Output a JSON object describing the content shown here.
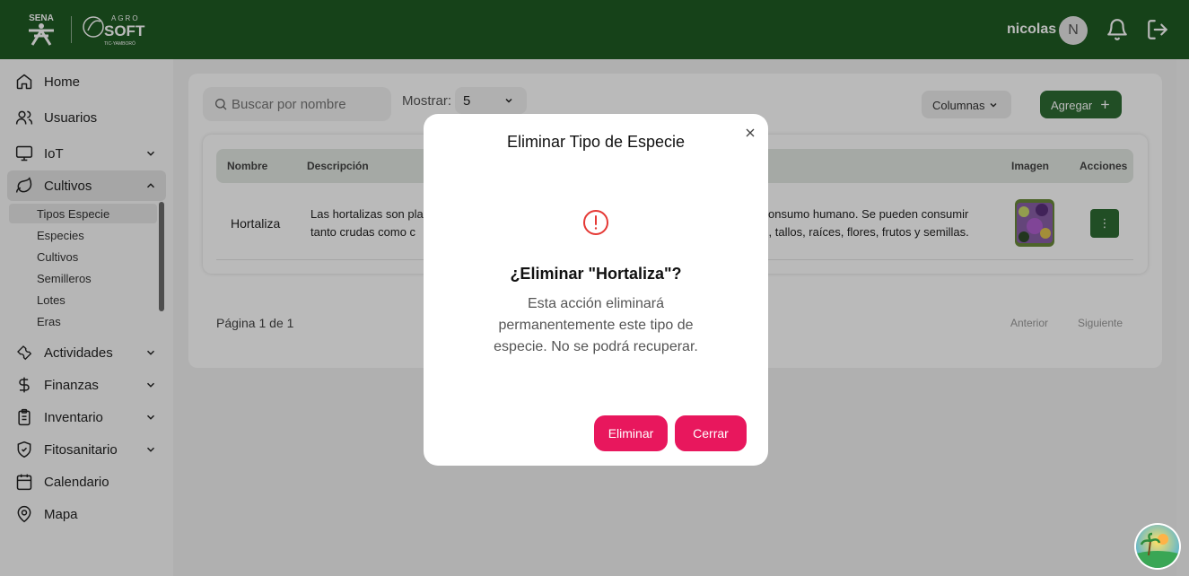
{
  "header": {
    "logo_sena": "SENA",
    "logo_agro_top": "AGRO",
    "logo_agro_main": "SOFT",
    "logo_agro_sub": "TIC-YAMBORÓ",
    "username": "nicolas",
    "avatar_initial": "N",
    "bg_color": "#1f5b23"
  },
  "sidebar": {
    "items": [
      {
        "label": "Home",
        "icon": "home-icon"
      },
      {
        "label": "Usuarios",
        "icon": "users-icon"
      },
      {
        "label": "IoT",
        "icon": "monitor-icon"
      },
      {
        "label": "Cultivos",
        "icon": "leaf-icon"
      },
      {
        "label": "Actividades",
        "icon": "wrench-icon"
      },
      {
        "label": "Finanzas",
        "icon": "dollar-icon"
      },
      {
        "label": "Inventario",
        "icon": "clipboard-icon"
      },
      {
        "label": "Fitosanitario",
        "icon": "shield-icon"
      },
      {
        "label": "Calendario",
        "icon": "calendar-icon"
      },
      {
        "label": "Mapa",
        "icon": "map-pin-icon"
      }
    ],
    "cultivos_sub": [
      "Tipos Especie",
      "Especies",
      "Cultivos",
      "Semilleros",
      "Lotes",
      "Eras"
    ]
  },
  "toolbar": {
    "search_placeholder": "Buscar por nombre",
    "show_label": "Mostrar:",
    "show_value": "5",
    "columns_label": "Columnas",
    "add_label": "Agregar"
  },
  "table": {
    "headers": [
      "Nombre",
      "Descripción",
      "Imagen",
      "Acciones"
    ],
    "rows": [
      {
        "nombre": "Hortaliza",
        "desc_left_1": "Las hortalizas son pla",
        "desc_left_2": "tanto crudas como c",
        "desc_right_1": "onsumo humano. Se pueden consumir",
        "desc_right_2": "s, tallos, raíces, flores, frutos y semillas.",
        "actions_glyph": "⋮"
      }
    ]
  },
  "pagination": {
    "text": "Página 1 de 1",
    "prev": "Anterior",
    "next": "Siguiente"
  },
  "modal": {
    "title": "Eliminar Tipo de Especie",
    "question": "¿Eliminar \"Hortaliza\"?",
    "message": "Esta acción eliminará permanentemente este tipo de especie. No se podrá recuperar.",
    "confirm_label": "Eliminar",
    "close_label": "Cerrar",
    "accent_color": "#e8175d",
    "alert_color": "#e53935"
  }
}
